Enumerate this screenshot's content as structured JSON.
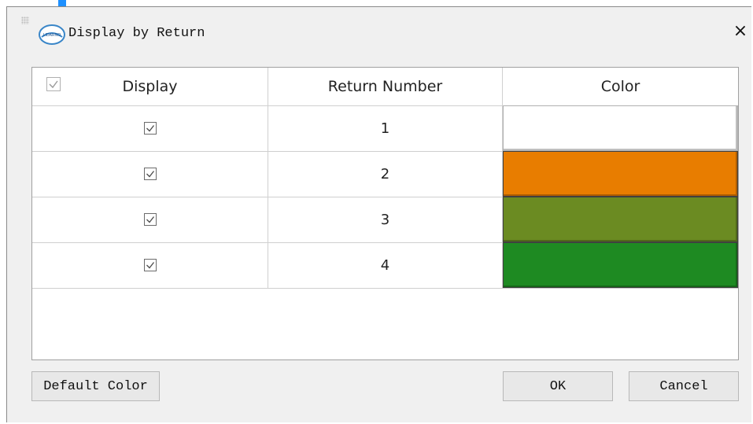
{
  "window": {
    "title": "Display by Return",
    "close_label": "×",
    "logo_text": "LIDARNO"
  },
  "table": {
    "headers": {
      "display": "Display",
      "return_number": "Return Number",
      "color": "Color"
    },
    "header_checkbox_checked": true,
    "rows": [
      {
        "checked": true,
        "return_number": "1",
        "color": "#ffffff"
      },
      {
        "checked": true,
        "return_number": "2",
        "color": "#e87d00"
      },
      {
        "checked": true,
        "return_number": "3",
        "color": "#6b8b22"
      },
      {
        "checked": true,
        "return_number": "4",
        "color": "#1e8a22"
      }
    ]
  },
  "buttons": {
    "default_color": "Default Color",
    "ok": "OK",
    "cancel": "Cancel"
  },
  "colors": {
    "accent": "#1e90ff",
    "dialog_bg": "#f0f0f0"
  },
  "icons": {
    "app_logo": "app-logo-icon",
    "close": "close-icon",
    "checkbox": "checkbox-checked-icon",
    "grip": "grip-icon"
  }
}
